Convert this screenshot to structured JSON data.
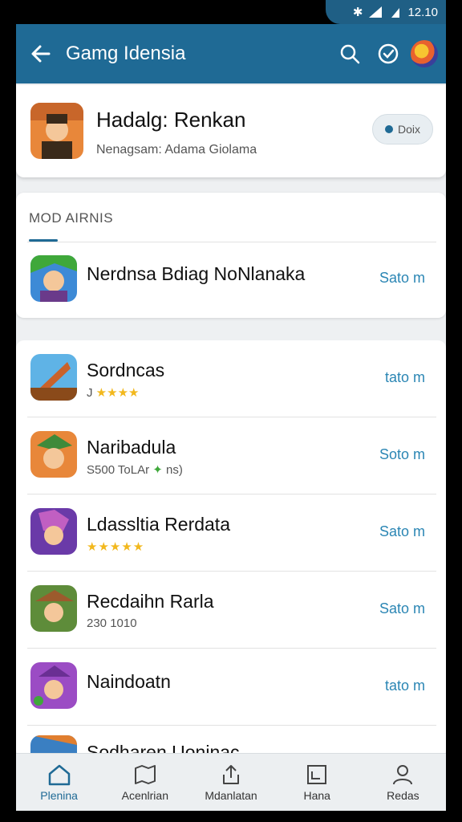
{
  "status": {
    "time": "12.10"
  },
  "appbar": {
    "title": "Gamg Idensia"
  },
  "featured": {
    "name": "Hadalg: Renkan",
    "subtitle": "Nenagsam: Adama Giolama",
    "button_label": "Doix"
  },
  "section": {
    "title": "MOD AIRNIS"
  },
  "mod_item": {
    "name": "Nerdnsa Bdiag NoNlanaka",
    "action": "Sato m"
  },
  "list": [
    {
      "name": "Sordncas",
      "rating_text": "J",
      "stars": "★★★★",
      "extra": "",
      "action": "tato m",
      "icon_colors": [
        "#5fb3e6",
        "#c9622a"
      ]
    },
    {
      "name": "Naribadula",
      "rating_text": "S500 ToLAr",
      "stars": "",
      "extra": "ns)",
      "action": "Soto m",
      "icon_colors": [
        "#e8873a",
        "#3f8a3a"
      ]
    },
    {
      "name": "Ldassltia Rerdata",
      "rating_text": "",
      "stars": "★★★★★",
      "extra": "",
      "action": "Sato m",
      "icon_colors": [
        "#6a3aa8",
        "#c15fc2"
      ]
    },
    {
      "name": "Recdaihn Rarla",
      "rating_text": "230 1010",
      "stars": "",
      "extra": "",
      "action": "Sato m",
      "icon_colors": [
        "#5e8c3a",
        "#9c5b2d"
      ]
    },
    {
      "name": "Naindoatn",
      "rating_text": "",
      "stars": "",
      "extra": "",
      "action": "tato m",
      "icon_colors": [
        "#9b4cc4",
        "#6a2f93"
      ]
    },
    {
      "name": "Sodharen Uoninac",
      "rating_text": "",
      "stars": "",
      "extra": "",
      "action": "",
      "icon_colors": [
        "#e07e2f",
        "#3a7fc2"
      ]
    }
  ],
  "bottom_nav": [
    {
      "label": "Plenina",
      "icon": "home-icon"
    },
    {
      "label": "Acenlrian",
      "icon": "map-icon"
    },
    {
      "label": "Mdanlatan",
      "icon": "share-icon"
    },
    {
      "label": "Hana",
      "icon": "image-icon"
    },
    {
      "label": "Redas",
      "icon": "profile-icon"
    }
  ],
  "colors": {
    "primary": "#1f6a95",
    "action_text": "#2b86b4",
    "star": "#f2b81d"
  }
}
